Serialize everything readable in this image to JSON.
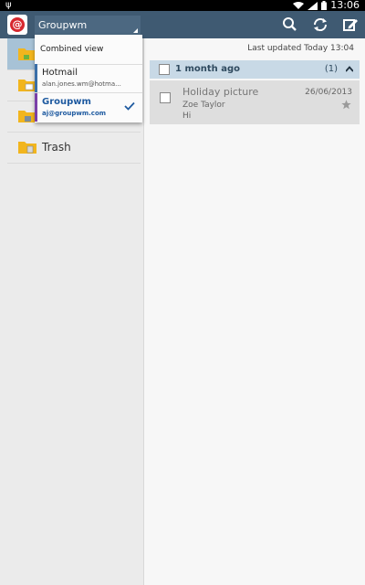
{
  "status_bar": {
    "time": "13:06",
    "icons": [
      "usb-icon",
      "wifi-icon",
      "signal-icon",
      "battery-icon"
    ]
  },
  "action_bar": {
    "app_icon": "email-app-icon",
    "account_selector": "Groupwm",
    "actions": [
      "search-icon",
      "refresh-icon",
      "compose-icon"
    ]
  },
  "account_dropdown": {
    "combined_label": "Combined view",
    "accounts": [
      {
        "name": "Hotmail",
        "email": "alan.jones.wm@hotma...",
        "color": "#3b6fa8",
        "selected": false
      },
      {
        "name": "Groupwm",
        "email": "aj@groupwm.com",
        "color": "#7a3fa8",
        "selected": true
      }
    ]
  },
  "folders": [
    {
      "label": "",
      "selected": true
    },
    {
      "label": "",
      "selected": false
    },
    {
      "label": "",
      "selected": false
    },
    {
      "label": "Trash",
      "selected": false
    }
  ],
  "message_list": {
    "last_updated_label": "Last updated",
    "last_updated_value": "Today 13:04",
    "group": {
      "label": "1 month ago",
      "count": "(1)"
    },
    "messages": [
      {
        "subject": "Holiday picture",
        "from": "Zoe Taylor",
        "preview": "Hi",
        "date": "26/06/2013"
      }
    ]
  },
  "colors": {
    "action_bar": "#3f5a72",
    "selected_folder": "#a7c2d6",
    "group_header": "#c8d9e6",
    "accent": "#1e5aa0"
  }
}
